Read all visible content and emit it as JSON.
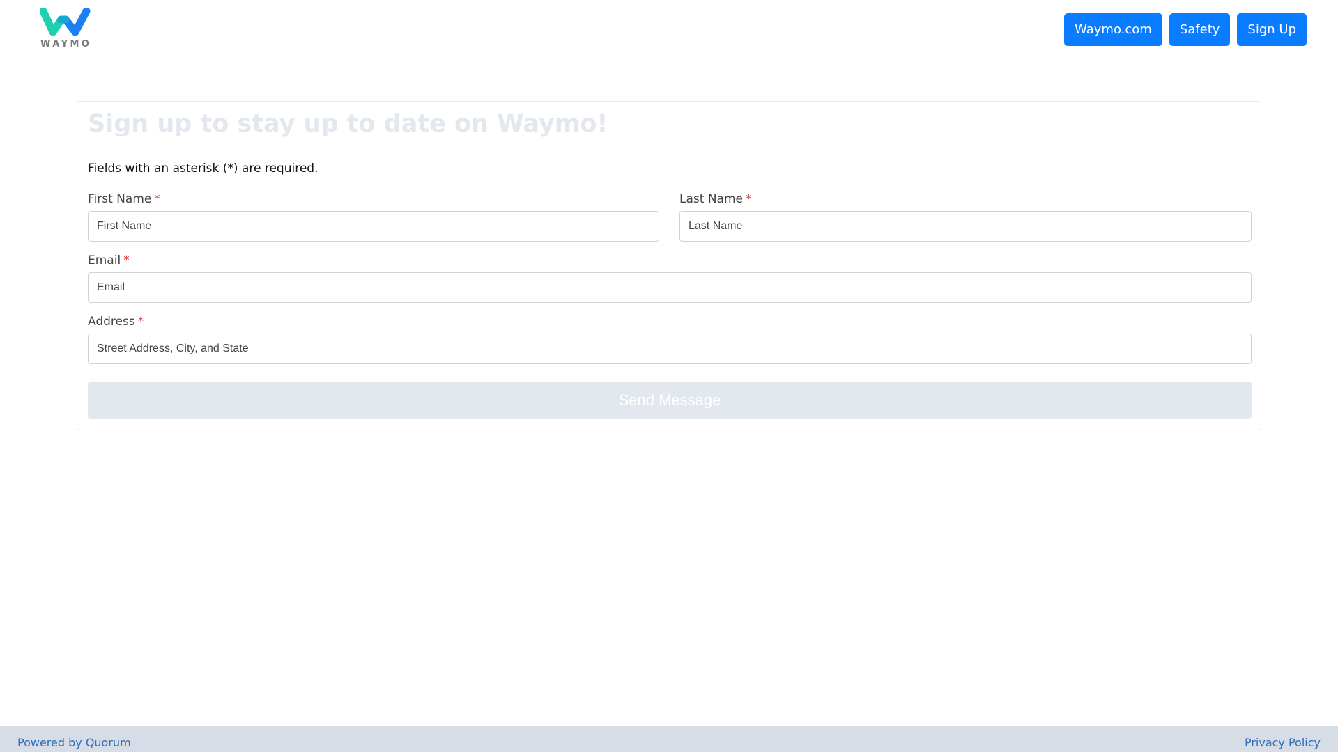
{
  "header": {
    "logo_text": "WAYMO",
    "logo_colors": {
      "left": "#1ecfb0",
      "right": "#1d7ff2"
    },
    "nav": [
      {
        "label": "Waymo.com"
      },
      {
        "label": "Safety"
      },
      {
        "label": "Sign Up"
      }
    ],
    "nav_color": "#0a7cff"
  },
  "form": {
    "title": "Sign up to stay up to date on Waymo!",
    "required_note": "Fields with an asterisk (*) are required.",
    "asterisk": "*",
    "fields": {
      "first_name": {
        "label": "First Name",
        "placeholder": "First Name",
        "value": ""
      },
      "last_name": {
        "label": "Last Name",
        "placeholder": "Last Name",
        "value": ""
      },
      "email": {
        "label": "Email",
        "placeholder": "Email",
        "value": ""
      },
      "address": {
        "label": "Address",
        "placeholder": "Street Address, City, and State",
        "value": ""
      }
    },
    "submit_label": "Send Message"
  },
  "footer": {
    "powered_by": "Powered by Quorum",
    "privacy": "Privacy Policy"
  }
}
